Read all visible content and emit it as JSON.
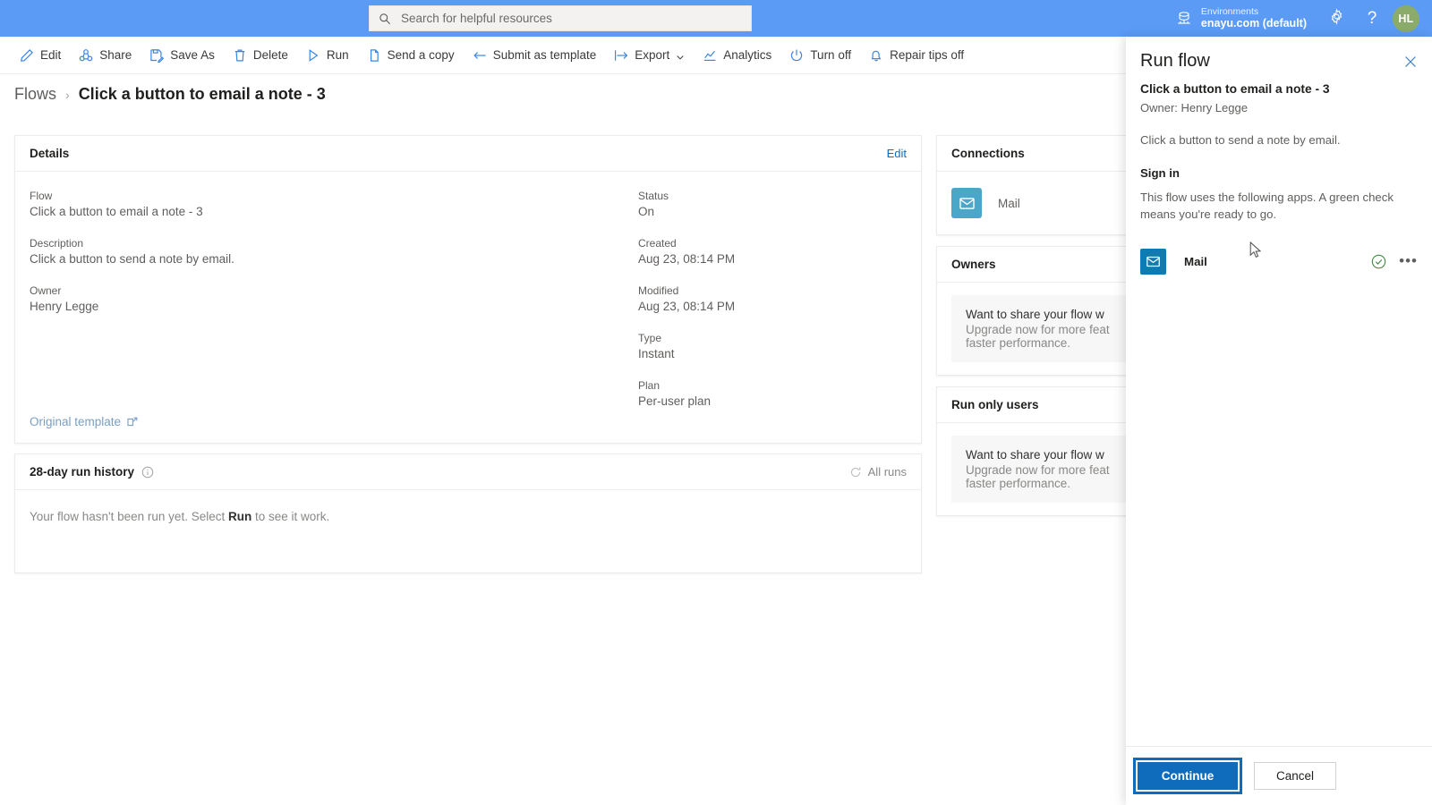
{
  "topbar": {
    "search": {
      "placeholder": "Search for helpful resources",
      "value": "",
      "icon": "search-icon"
    },
    "environment": {
      "label": "Environments",
      "value": "enayu.com (default)",
      "icon": "environment-icon"
    },
    "settings_icon": "gear-icon",
    "help_icon": "question-mark-icon",
    "avatar_initials": "HL",
    "avatar_color": "#8bab6a",
    "bar_color": "#5b9bf5"
  },
  "commandbar": {
    "items": [
      {
        "label": "Edit",
        "icon": "pencil-icon"
      },
      {
        "label": "Share",
        "icon": "share-icon"
      },
      {
        "label": "Save As",
        "icon": "save-as-icon"
      },
      {
        "label": "Delete",
        "icon": "trash-icon"
      },
      {
        "label": "Run",
        "icon": "play-icon"
      },
      {
        "label": "Send a copy",
        "icon": "copy-icon"
      },
      {
        "label": "Submit as template",
        "icon": "submit-template-icon"
      },
      {
        "label": "Export",
        "icon": "export-icon",
        "has_chevron": true
      },
      {
        "label": "Analytics",
        "icon": "analytics-icon"
      },
      {
        "label": "Turn off",
        "icon": "power-icon"
      },
      {
        "label": "Repair tips off",
        "icon": "bell-icon"
      }
    ]
  },
  "breadcrumb": {
    "parent": "Flows",
    "separator": "›",
    "current": "Click a button to email a note - 3"
  },
  "details": {
    "title": "Details",
    "edit_label": "Edit",
    "left_fields": [
      {
        "label": "Flow",
        "value": "Click a button to email a note - 3"
      },
      {
        "label": "Description",
        "value": "Click a button to send a note by email."
      },
      {
        "label": "Owner",
        "value": "Henry Legge"
      }
    ],
    "right_fields": [
      {
        "label": "Status",
        "value": "On"
      },
      {
        "label": "Created",
        "value": "Aug 23, 08:14 PM"
      },
      {
        "label": "Modified",
        "value": "Aug 23, 08:14 PM"
      },
      {
        "label": "Type",
        "value": "Instant"
      },
      {
        "label": "Plan",
        "value": "Per-user plan"
      }
    ],
    "original_template_link": "Original template"
  },
  "run_history": {
    "title": "28-day run history",
    "info_icon": "info-icon",
    "all_runs_label": "All runs",
    "refresh_icon": "refresh-icon",
    "empty_text_before": "Your flow hasn't been run yet. Select ",
    "empty_text_bold": "Run",
    "empty_text_after": " to see it work."
  },
  "sidebar_cards": [
    {
      "title": "Connections",
      "type": "connections",
      "connection_name": "Mail",
      "connection_icon": "mail-icon",
      "connection_color": "#4aa7c9"
    },
    {
      "title": "Owners",
      "type": "promo",
      "promo_line1": "Want to share your flow w",
      "promo_line2": "Upgrade now for more feat",
      "promo_line3": "faster performance."
    },
    {
      "title": "Run only users",
      "type": "promo",
      "promo_line1": "Want to share your flow w",
      "promo_line2": "Upgrade now for more feat",
      "promo_line3": "faster performance."
    }
  ],
  "run_flow_panel": {
    "title": "Run flow",
    "close_icon": "close-icon",
    "flow_name": "Click a button to email a note - 3",
    "owner": "Owner: Henry Legge",
    "description": "Click a button to send a note by email.",
    "signin_heading": "Sign in",
    "signin_description": "This flow uses the following apps. A green check means you're ready to go.",
    "app": {
      "name": "Mail",
      "icon": "mail-icon",
      "icon_color": "#0f7bb0",
      "status_icon": "green-check-icon",
      "status_color": "#3b8a3f",
      "more_icon": "ellipsis-icon"
    },
    "continue_label": "Continue",
    "cancel_label": "Cancel",
    "accent_color": "#0f6cbd"
  }
}
